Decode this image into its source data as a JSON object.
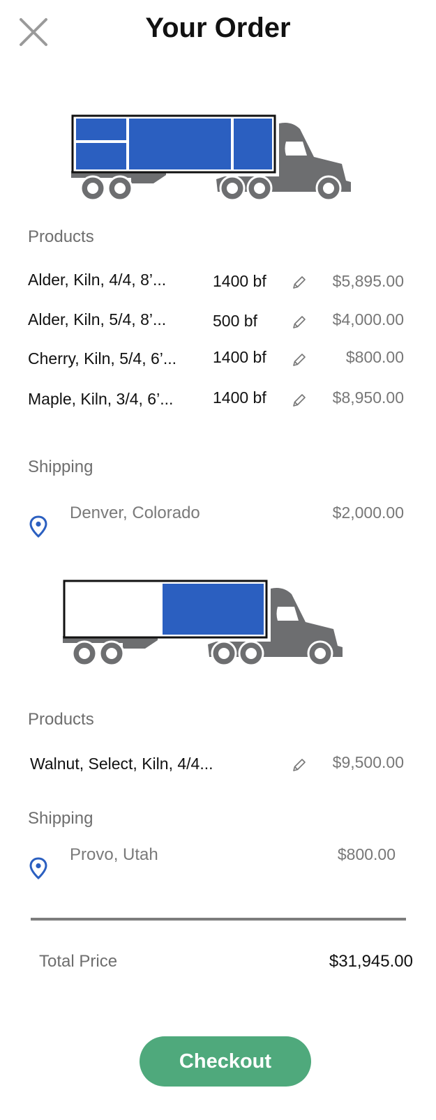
{
  "header": {
    "title": "Your Order"
  },
  "orders": [
    {
      "truck_fill_percent": 100,
      "products_label": "Products",
      "products": [
        {
          "name": "Alder, Kiln, 4/4, 8’...",
          "qty": "1400 bf",
          "price": "$5,895.00"
        },
        {
          "name": "Alder, Kiln, 5/4, 8’...",
          "qty": "500 bf",
          "price": "$4,000.00"
        },
        {
          "name": "Cherry, Kiln, 5/4, 6’...",
          "qty": "1400 bf",
          "price": "$800.00"
        },
        {
          "name": "Maple, Kiln, 3/4, 6’...",
          "qty": "1400 bf",
          "price": "$8,950.00"
        }
      ],
      "shipping_label": "Shipping",
      "shipping": {
        "location": "Denver, Colorado",
        "price": "$2,000.00"
      }
    },
    {
      "truck_fill_percent": 50,
      "products_label": "Products",
      "products": [
        {
          "name": "Walnut,  Select, Kiln, 4/4...",
          "qty": "",
          "price": "$9,500.00"
        }
      ],
      "shipping_label": "Shipping",
      "shipping": {
        "location": "Provo, Utah",
        "price": "$800.00"
      }
    }
  ],
  "total": {
    "label": "Total Price",
    "value": "$31,945.00"
  },
  "checkout_label": "Checkout",
  "colors": {
    "accent_blue": "#2b5fc0",
    "checkout_green": "#4fa97c",
    "truck_gray": "#6d6e70"
  },
  "icons": [
    "close-icon",
    "truck-icon",
    "pencil-icon",
    "location-pin-icon"
  ]
}
